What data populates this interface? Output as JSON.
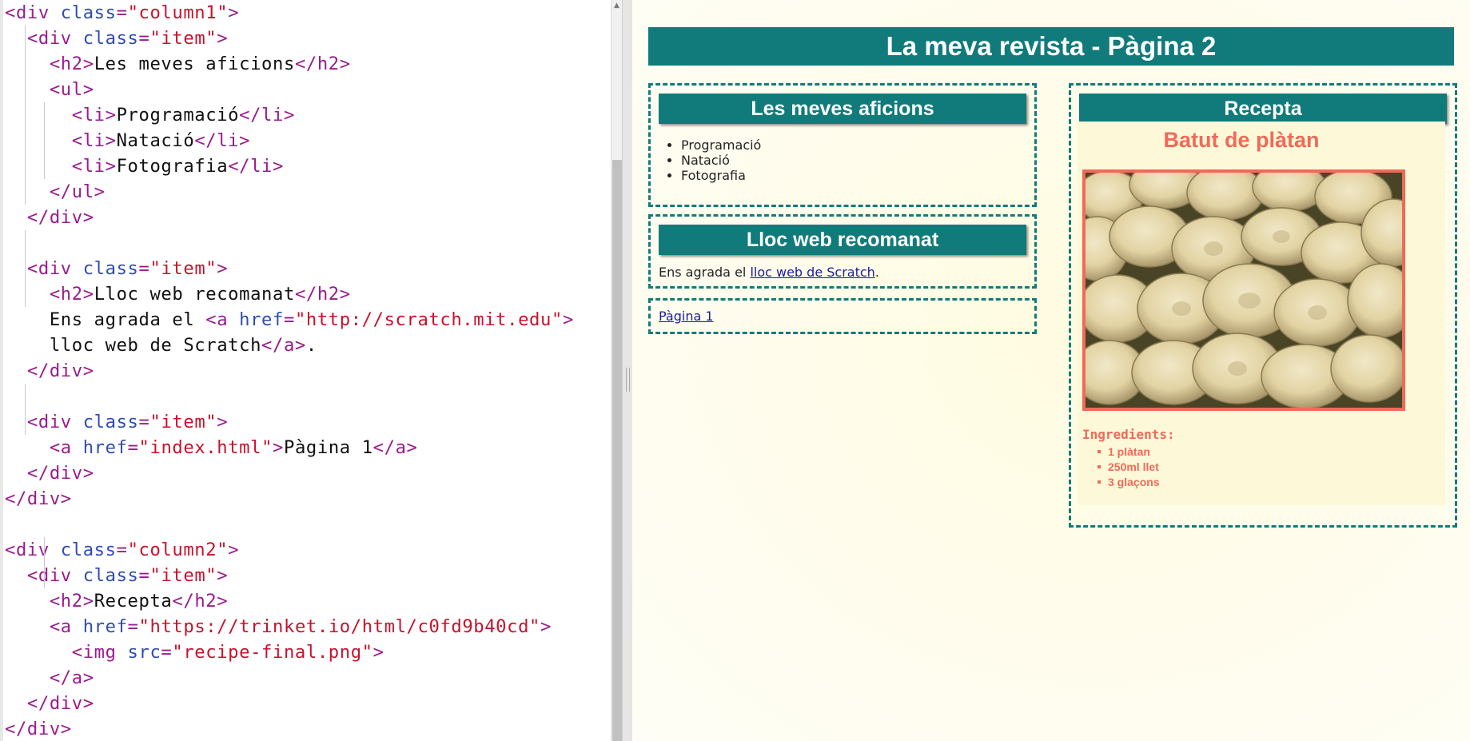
{
  "editor": {
    "lines": [
      [
        {
          "c": "tag",
          "t": "<div "
        },
        {
          "c": "attr",
          "t": "class"
        },
        {
          "c": "tag",
          "t": "="
        },
        {
          "c": "str",
          "t": "\"column1\""
        },
        {
          "c": "tag",
          "t": ">"
        }
      ],
      [
        {
          "c": "txt",
          "t": "  "
        },
        {
          "c": "tag",
          "t": "<div "
        },
        {
          "c": "attr",
          "t": "class"
        },
        {
          "c": "tag",
          "t": "="
        },
        {
          "c": "str",
          "t": "\"item\""
        },
        {
          "c": "tag",
          "t": ">"
        }
      ],
      [
        {
          "c": "txt",
          "t": "    "
        },
        {
          "c": "tag",
          "t": "<h2>"
        },
        {
          "c": "txt",
          "t": "Les meves aficions"
        },
        {
          "c": "tag",
          "t": "</h2>"
        }
      ],
      [
        {
          "c": "txt",
          "t": "    "
        },
        {
          "c": "tag",
          "t": "<ul>"
        }
      ],
      [
        {
          "c": "txt",
          "t": "      "
        },
        {
          "c": "tag",
          "t": "<li>"
        },
        {
          "c": "txt",
          "t": "Programació"
        },
        {
          "c": "tag",
          "t": "</li>"
        }
      ],
      [
        {
          "c": "txt",
          "t": "      "
        },
        {
          "c": "tag",
          "t": "<li>"
        },
        {
          "c": "txt",
          "t": "Natació"
        },
        {
          "c": "tag",
          "t": "</li>"
        }
      ],
      [
        {
          "c": "txt",
          "t": "      "
        },
        {
          "c": "tag",
          "t": "<li>"
        },
        {
          "c": "txt",
          "t": "Fotografia"
        },
        {
          "c": "tag",
          "t": "</li>"
        }
      ],
      [
        {
          "c": "txt",
          "t": "    "
        },
        {
          "c": "tag",
          "t": "</ul>"
        }
      ],
      [
        {
          "c": "txt",
          "t": "  "
        },
        {
          "c": "tag",
          "t": "</div>"
        }
      ],
      [],
      [
        {
          "c": "txt",
          "t": "  "
        },
        {
          "c": "tag",
          "t": "<div "
        },
        {
          "c": "attr",
          "t": "class"
        },
        {
          "c": "tag",
          "t": "="
        },
        {
          "c": "str",
          "t": "\"item\""
        },
        {
          "c": "tag",
          "t": ">"
        }
      ],
      [
        {
          "c": "txt",
          "t": "    "
        },
        {
          "c": "tag",
          "t": "<h2>"
        },
        {
          "c": "txt",
          "t": "Lloc web recomanat"
        },
        {
          "c": "tag",
          "t": "</h2>"
        }
      ],
      [
        {
          "c": "txt",
          "t": "    Ens agrada el "
        },
        {
          "c": "tag",
          "t": "<a "
        },
        {
          "c": "attr",
          "t": "href"
        },
        {
          "c": "tag",
          "t": "="
        },
        {
          "c": "str",
          "t": "\"http://scratch.mit.edu\""
        },
        {
          "c": "tag",
          "t": ">"
        }
      ],
      [
        {
          "c": "txt",
          "t": "    lloc web de Scratch"
        },
        {
          "c": "tag",
          "t": "</a>"
        },
        {
          "c": "txt",
          "t": "."
        }
      ],
      [
        {
          "c": "txt",
          "t": "  "
        },
        {
          "c": "tag",
          "t": "</div>"
        }
      ],
      [],
      [
        {
          "c": "txt",
          "t": "  "
        },
        {
          "c": "tag",
          "t": "<div "
        },
        {
          "c": "attr",
          "t": "class"
        },
        {
          "c": "tag",
          "t": "="
        },
        {
          "c": "str",
          "t": "\"item\""
        },
        {
          "c": "tag",
          "t": ">"
        }
      ],
      [
        {
          "c": "txt",
          "t": "    "
        },
        {
          "c": "tag",
          "t": "<a "
        },
        {
          "c": "attr",
          "t": "href"
        },
        {
          "c": "tag",
          "t": "="
        },
        {
          "c": "str",
          "t": "\"index.html\""
        },
        {
          "c": "tag",
          "t": ">"
        },
        {
          "c": "txt",
          "t": "Pàgina 1"
        },
        {
          "c": "tag",
          "t": "</a>"
        }
      ],
      [
        {
          "c": "txt",
          "t": "  "
        },
        {
          "c": "tag",
          "t": "</div>"
        }
      ],
      [
        {
          "c": "tag",
          "t": "</div>"
        }
      ],
      [],
      [
        {
          "c": "tag",
          "t": "<div "
        },
        {
          "c": "attr",
          "t": "class"
        },
        {
          "c": "tag",
          "t": "="
        },
        {
          "c": "str",
          "t": "\"column2\""
        },
        {
          "c": "tag",
          "t": ">"
        }
      ],
      [
        {
          "c": "txt",
          "t": "  "
        },
        {
          "c": "tag",
          "t": "<div "
        },
        {
          "c": "attr",
          "t": "class"
        },
        {
          "c": "tag",
          "t": "="
        },
        {
          "c": "str",
          "t": "\"item\""
        },
        {
          "c": "tag",
          "t": ">"
        }
      ],
      [
        {
          "c": "txt",
          "t": "    "
        },
        {
          "c": "tag",
          "t": "<h2>"
        },
        {
          "c": "txt",
          "t": "Recepta"
        },
        {
          "c": "tag",
          "t": "</h2>"
        }
      ],
      [
        {
          "c": "txt",
          "t": "    "
        },
        {
          "c": "tag",
          "t": "<a "
        },
        {
          "c": "attr",
          "t": "href"
        },
        {
          "c": "tag",
          "t": "="
        },
        {
          "c": "str",
          "t": "\"https://trinket.io/html/c0fd9b40cd\""
        },
        {
          "c": "tag",
          "t": ">"
        }
      ],
      [
        {
          "c": "txt",
          "t": "      "
        },
        {
          "c": "tag",
          "t": "<img "
        },
        {
          "c": "attr",
          "t": "src"
        },
        {
          "c": "tag",
          "t": "="
        },
        {
          "c": "str",
          "t": "\"recipe-final.png\""
        },
        {
          "c": "tag",
          "t": ">"
        }
      ],
      [
        {
          "c": "txt",
          "t": "    "
        },
        {
          "c": "tag",
          "t": "</a>"
        }
      ],
      [
        {
          "c": "txt",
          "t": "  "
        },
        {
          "c": "tag",
          "t": "</div>"
        }
      ],
      [
        {
          "c": "tag",
          "t": "</div>"
        }
      ]
    ]
  },
  "preview": {
    "title": "La meva revista - Pàgina 2",
    "hobbies": {
      "heading": "Les meves aficions",
      "items": [
        "Programació",
        "Natació",
        "Fotografia"
      ]
    },
    "website": {
      "heading": "Lloc web recomanat",
      "text_before": "Ens agrada el ",
      "link": "lloc web de Scratch",
      "text_after": "."
    },
    "nav": {
      "link": "Pàgina 1"
    },
    "recipe": {
      "heading": "Recepta",
      "name": "Batut de plàtan",
      "ingredients_title": "Ingredients:",
      "ingredients": [
        "1 plàtan",
        "250ml llet",
        "3 glaçons"
      ]
    }
  },
  "colors": {
    "teal": "#117b7b",
    "coral": "#f06a5a",
    "code_tag": "#9a1b8e",
    "code_attr": "#2f4db0",
    "code_string": "#c8122c"
  }
}
